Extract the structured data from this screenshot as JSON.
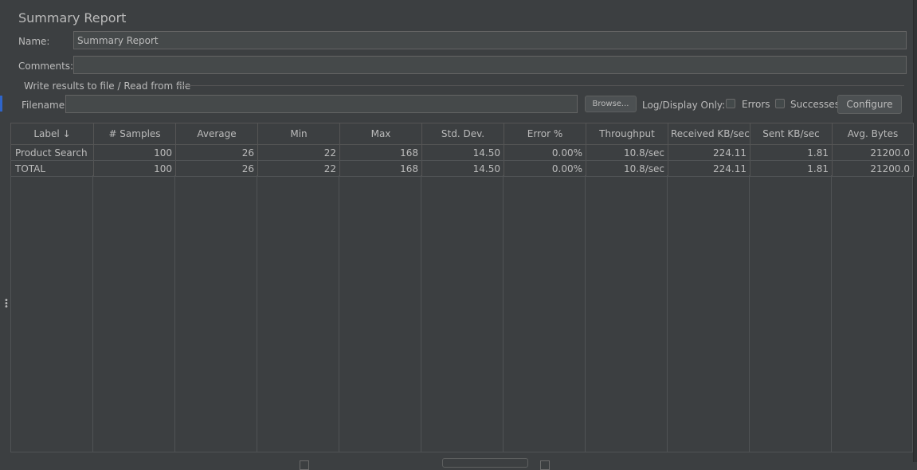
{
  "panel": {
    "title": "Summary Report",
    "name_label": "Name:",
    "name_value": "Summary Report",
    "comments_label": "Comments:",
    "comments_value": "",
    "file_group_title": "Write results to file / Read from file",
    "filename_label": "Filename",
    "filename_value": "",
    "browse_label": "Browse...",
    "log_display_label": "Log/Display Only:",
    "errors_label": "Errors",
    "errors_checked": false,
    "successes_label": "Successes",
    "successes_checked": false,
    "configure_label": "Configure"
  },
  "table": {
    "columns": [
      "Label ↓",
      "# Samples",
      "Average",
      "Min",
      "Max",
      "Std. Dev.",
      "Error %",
      "Throughput",
      "Received KB/sec",
      "Sent KB/sec",
      "Avg. Bytes"
    ],
    "rows": [
      [
        "Product Search",
        "100",
        "26",
        "22",
        "168",
        "14.50",
        "0.00%",
        "10.8/sec",
        "224.11",
        "1.81",
        "21200.0"
      ],
      [
        "TOTAL",
        "100",
        "26",
        "22",
        "168",
        "14.50",
        "0.00%",
        "10.8/sec",
        "224.11",
        "1.81",
        "21200.0"
      ]
    ]
  },
  "colors": {
    "background": "#3c3f41",
    "field": "#45494a",
    "text": "#bbbbbb",
    "grid": "#555555"
  }
}
